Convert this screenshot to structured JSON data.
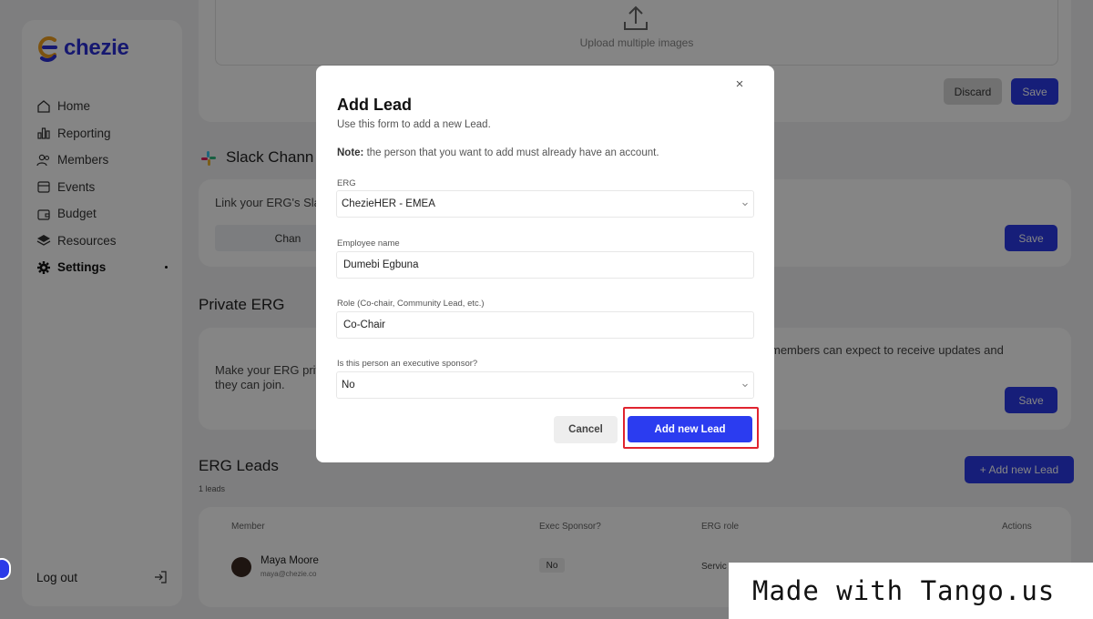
{
  "brand": {
    "name": "chezie",
    "color": "#2b2fd6",
    "accent": "#f0a020"
  },
  "sidebar": {
    "items": [
      {
        "label": "Home",
        "icon": "home-icon"
      },
      {
        "label": "Reporting",
        "icon": "bar-chart-icon"
      },
      {
        "label": "Members",
        "icon": "users-icon"
      },
      {
        "label": "Events",
        "icon": "calendar-icon"
      },
      {
        "label": "Budget",
        "icon": "wallet-icon"
      },
      {
        "label": "Resources",
        "icon": "layers-icon"
      },
      {
        "label": "Settings",
        "icon": "gear-icon",
        "active": true
      }
    ],
    "logout_label": "Log out"
  },
  "background": {
    "upload_label": "Upload multiple images",
    "discard_label": "Discard",
    "save_label": "Save",
    "slack_title": "Slack Chann",
    "slack_text": "Link your ERG's Slac",
    "slack_button": "Chan",
    "private_title": "Private ERG",
    "private_text_line1": "Make your ERG priv",
    "private_text_line2": "they can join.",
    "private_text_right": "members can expect to receive updates and",
    "leads_title": "ERG Leads",
    "leads_count": "1 leads",
    "add_lead_button": "+ Add new Lead",
    "table_headers": [
      "Member",
      "Exec Sponsor?",
      "ERG role",
      "Actions"
    ],
    "row": {
      "name": "Maya Moore",
      "email": "maya@chezie.co",
      "exec": "No",
      "role": "Servic"
    }
  },
  "modal": {
    "close_glyph": "×",
    "title": "Add Lead",
    "subtitle": "Use this form to add a new Lead.",
    "note_bold": "Note:",
    "note_text": " the person that you want to add must already have an account.",
    "fields": {
      "erg": {
        "label": "ERG",
        "value": "ChezieHER - EMEA"
      },
      "employee": {
        "label": "Employee name",
        "value": "Dumebi Egbuna"
      },
      "role": {
        "label": "Role (Co-chair, Community Lead, etc.)",
        "value": "Co-Chair"
      },
      "sponsor": {
        "label": "Is this person an executive sponsor?",
        "value": "No"
      }
    },
    "cancel_label": "Cancel",
    "submit_label": "Add new Lead",
    "submit_color": "#2b3cf0",
    "highlight_color": "#e0242f"
  },
  "watermark": "Made with Tango.us"
}
